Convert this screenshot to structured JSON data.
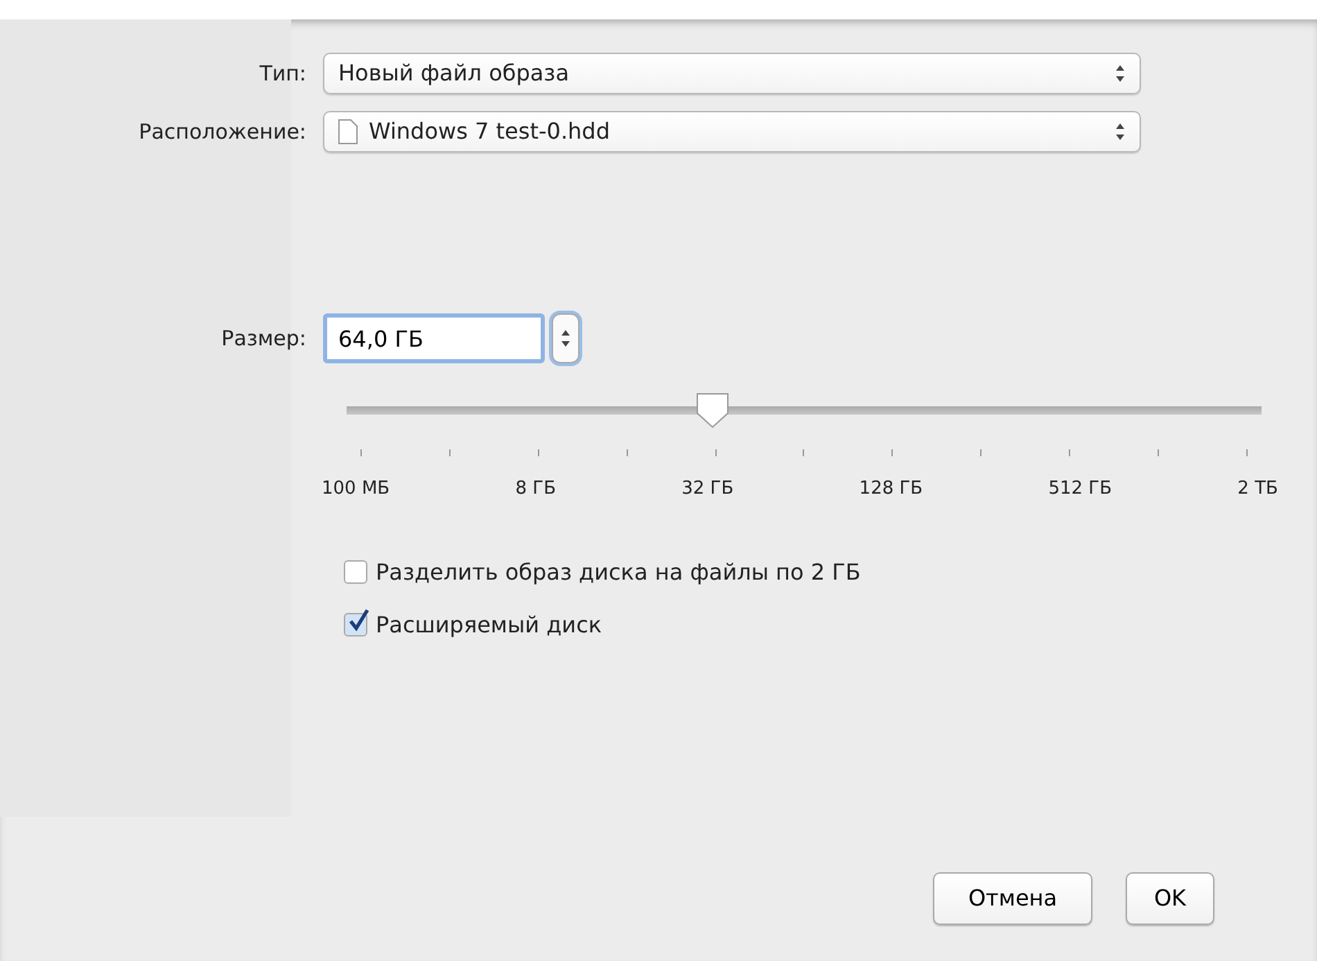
{
  "fields": [
    {
      "label": "Тип:",
      "kind": "popup",
      "value": "Новый файл образа"
    },
    {
      "label": "Расположение:",
      "kind": "file-popup",
      "value": "Windows 7 test-0.hdd"
    }
  ],
  "size": {
    "label": "Размер:",
    "value": "64,0 ГБ",
    "level": 0.4,
    "ticks": [
      "100 МБ",
      "8 ГБ",
      "32 ГБ",
      "128 ГБ",
      "512 ГБ",
      "2 ТБ"
    ]
  },
  "options": [
    {
      "label": "Разделить образ диска на файлы по 2 ГБ",
      "checked": false
    },
    {
      "label": "Расширяемый диск",
      "checked": true
    }
  ],
  "buttons": [
    {
      "label": "Отмена",
      "kind": "cancel"
    },
    {
      "label": "OK",
      "kind": "default"
    }
  ]
}
